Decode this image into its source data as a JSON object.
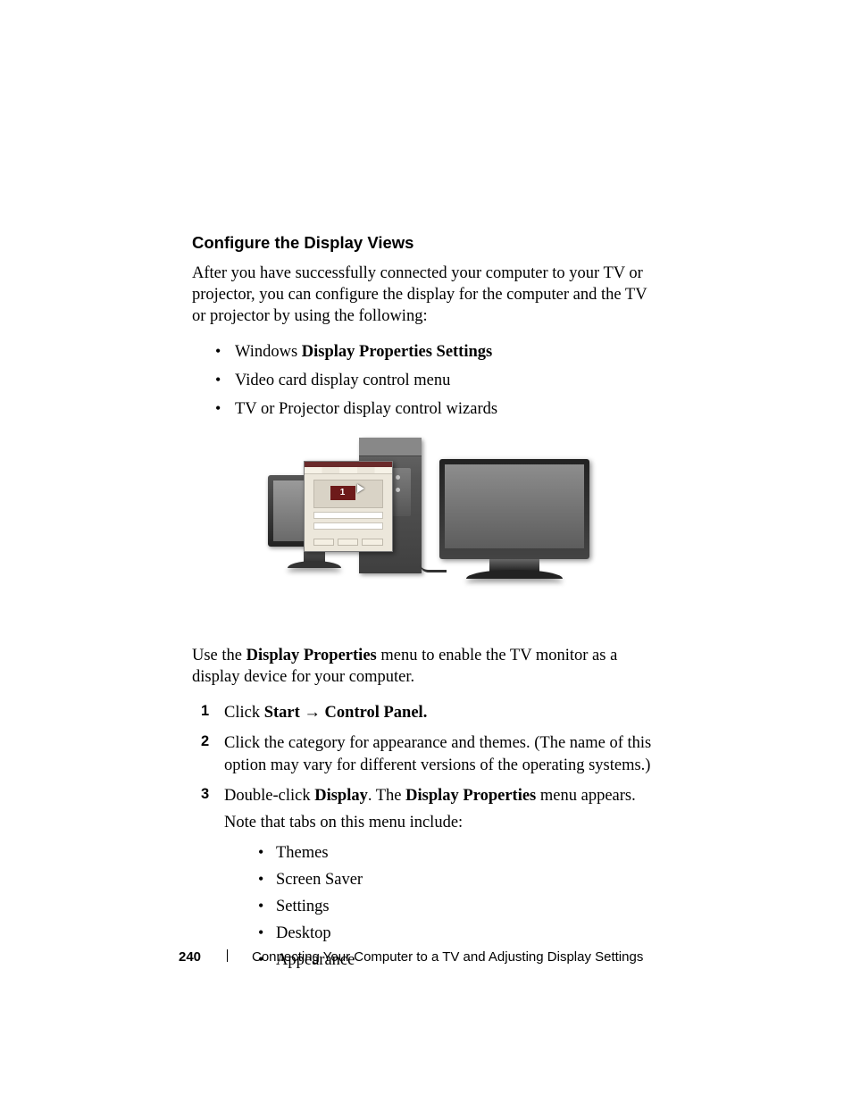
{
  "heading": "Configure the Display Views",
  "intro": "After you have successfully connected your computer to your TV or projector, you can configure the display for the computer and the TV or projector by using the following:",
  "optionA_prefix": "Windows ",
  "optionA_bold": "Display Properties Settings",
  "optionB": "Video card display control menu",
  "optionC": "TV or Projector display control wizards",
  "chip_label": "1",
  "useline_a": "Use the ",
  "useline_bold": "Display Properties",
  "useline_b": " menu to enable the TV monitor as a display device for your computer.",
  "step1_a": "Click ",
  "step1_b1": "Start",
  "step1_c": " → ",
  "step1_b2": "Control Panel.",
  "step2": "Click the category for appearance and themes. (The name of this option may vary for different versions of the operating systems.)",
  "step3_a": "Double-click ",
  "step3_b1": "Display",
  "step3_c": ". The ",
  "step3_b2": "Display Properties",
  "step3_d": " menu appears.",
  "subnote": "Note that tabs on this menu include:",
  "tab1": "Themes",
  "tab2": "Screen Saver",
  "tab3": "Settings",
  "tab4": "Desktop",
  "tab5": "Appearance",
  "page_number": "240",
  "footer_title": "Connecting Your Computer to a TV and Adjusting Display Settings",
  "n1": "1",
  "n2": "2",
  "n3": "3"
}
